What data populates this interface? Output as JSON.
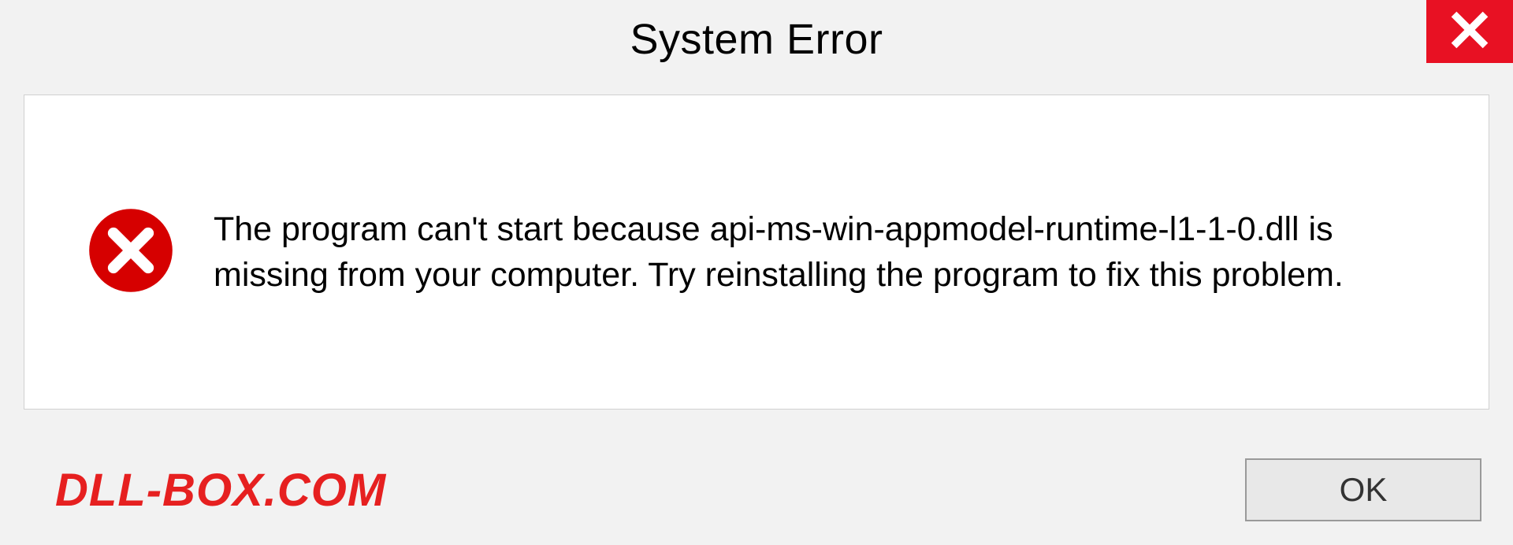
{
  "titlebar": {
    "title": "System Error",
    "close_icon": "close"
  },
  "content": {
    "error_icon": "error-circle",
    "message": "The program can't start because api-ms-win-appmodel-runtime-l1-1-0.dll is missing from your computer. Try reinstalling the program to fix this problem."
  },
  "footer": {
    "watermark": "DLL-BOX.COM",
    "ok_label": "OK"
  },
  "colors": {
    "close_bg": "#e81123",
    "error_red": "#d60000",
    "watermark_red": "#e62020",
    "panel_bg": "#ffffff",
    "body_bg": "#f2f2f2"
  }
}
